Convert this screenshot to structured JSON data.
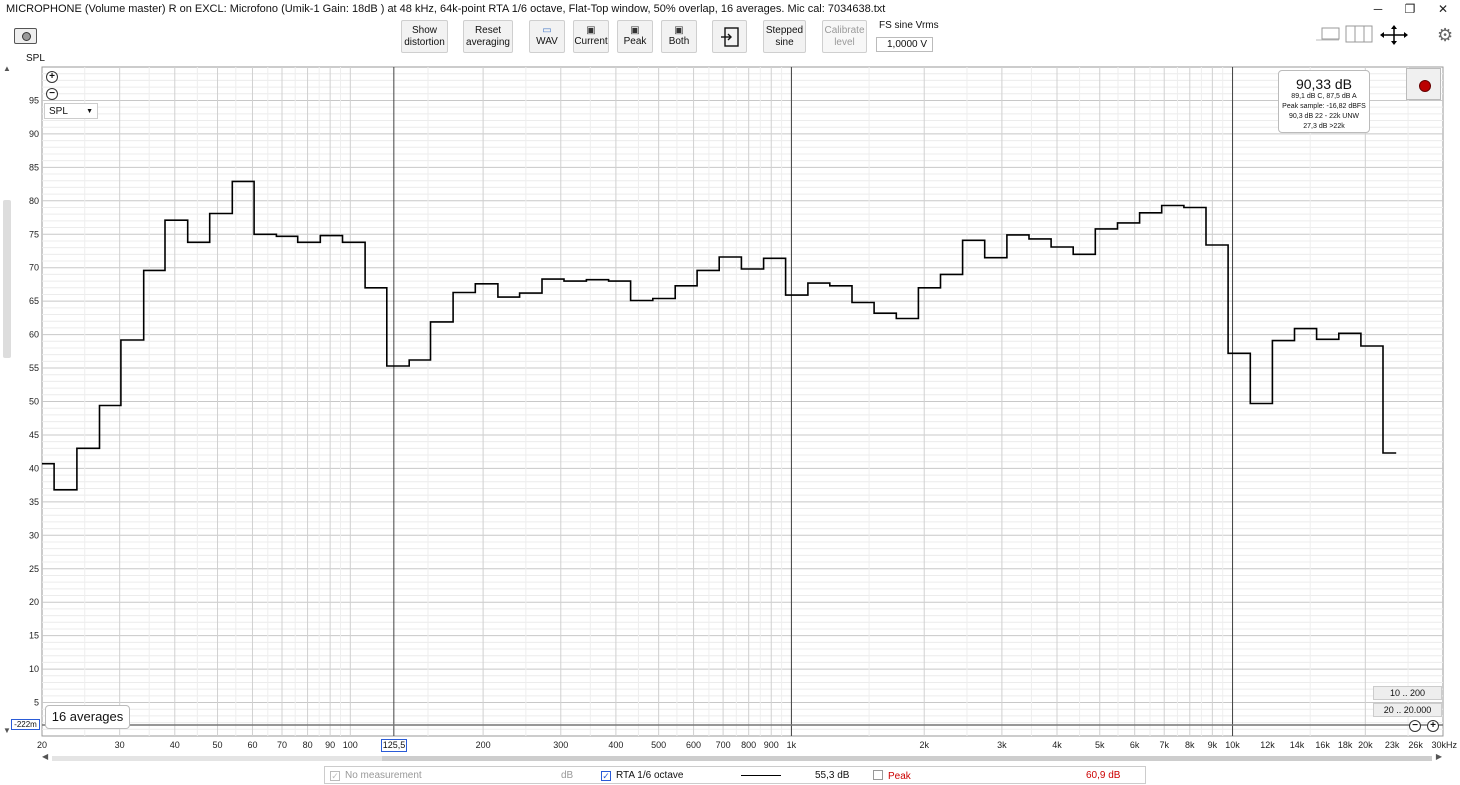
{
  "window": {
    "title": "MICROPHONE (Volume master) R on EXCL: Microfono (Umik-1  Gain: 18dB  ) at 48 kHz, 64k-point RTA 1/6 octave, Flat-Top window, 50% overlap, 16 averages. Mic cal: 7034638.txt",
    "minimize": "─",
    "restore": "❐",
    "close": "✕"
  },
  "toolbar": {
    "show_distortion": [
      "Show",
      "distortion"
    ],
    "reset_averaging": [
      "Reset",
      "averaging"
    ],
    "wav": "WAV",
    "current": "Current",
    "peak": "Peak",
    "both": "Both",
    "stepped_sine": [
      "Stepped",
      "sine"
    ],
    "calibrate_level": [
      "Calibrate",
      "level"
    ],
    "fs_label": "FS sine Vrms",
    "fs_value": "1,0000 V"
  },
  "plot": {
    "y_axis_label": "SPL",
    "spl_select": "SPL",
    "y_min_readout": "-222m",
    "cursor_readout": "125,5",
    "averages_badge": "16 averages",
    "range_buttons": [
      "10 .. 200",
      "20 .. 20.000"
    ]
  },
  "level_meter": {
    "main": "90,33 dB",
    "lines": [
      "89,1 dB C, 87,5 dB A",
      "Peak sample: -16,82 dBFS",
      "90,3 dB 22 - 22k UNW",
      "27,3 dB >22k"
    ]
  },
  "legend": {
    "no_measurement": "No measurement",
    "no_measurement_unit": "dB",
    "rta_label": "RTA 1/6 octave",
    "rta_value": "55,3 dB",
    "peak_label": "Peak",
    "peak_value": "60,9 dB",
    "colors": {
      "rta": "#000000",
      "peak": "#cc0000",
      "disabled": "#999999"
    }
  },
  "chart_data": {
    "type": "line",
    "step": true,
    "xscale": "log",
    "ylabel": "SPL",
    "xlim": [
      20,
      30000
    ],
    "ylim": [
      0,
      100
    ],
    "y_ticks": [
      5,
      10,
      15,
      20,
      25,
      30,
      35,
      40,
      45,
      50,
      55,
      60,
      65,
      70,
      75,
      80,
      85,
      90,
      95
    ],
    "x_tick_labels": [
      {
        "v": 20,
        "t": "20"
      },
      {
        "v": 30,
        "t": "30"
      },
      {
        "v": 40,
        "t": "40"
      },
      {
        "v": 50,
        "t": "50"
      },
      {
        "v": 60,
        "t": "60"
      },
      {
        "v": 70,
        "t": "70"
      },
      {
        "v": 80,
        "t": "80"
      },
      {
        "v": 90,
        "t": "90"
      },
      {
        "v": 100,
        "t": "100"
      },
      {
        "v": 200,
        "t": "200"
      },
      {
        "v": 300,
        "t": "300"
      },
      {
        "v": 400,
        "t": "400"
      },
      {
        "v": 500,
        "t": "500"
      },
      {
        "v": 600,
        "t": "600"
      },
      {
        "v": 700,
        "t": "700"
      },
      {
        "v": 800,
        "t": "800"
      },
      {
        "v": 900,
        "t": "900"
      },
      {
        "v": 1000,
        "t": "1k"
      },
      {
        "v": 2000,
        "t": "2k"
      },
      {
        "v": 3000,
        "t": "3k"
      },
      {
        "v": 4000,
        "t": "4k"
      },
      {
        "v": 5000,
        "t": "5k"
      },
      {
        "v": 6000,
        "t": "6k"
      },
      {
        "v": 7000,
        "t": "7k"
      },
      {
        "v": 8000,
        "t": "8k"
      },
      {
        "v": 9000,
        "t": "9k"
      },
      {
        "v": 10000,
        "t": "10k"
      },
      {
        "v": 12000,
        "t": "12k"
      },
      {
        "v": 14000,
        "t": "14k"
      },
      {
        "v": 16000,
        "t": "16k"
      },
      {
        "v": 18000,
        "t": "18k"
      },
      {
        "v": 20000,
        "t": "20k"
      },
      {
        "v": 23000,
        "t": "23k"
      },
      {
        "v": 26000,
        "t": "26k"
      },
      {
        "v": 30000,
        "t": "30kHz"
      }
    ],
    "major_vlines": [
      125.5,
      1000,
      10000
    ],
    "series": [
      {
        "edges": [
          20,
          21.3,
          24,
          27,
          30.2,
          34,
          38,
          42.8,
          48,
          54,
          60.5,
          68,
          76,
          85.5,
          96,
          108,
          121,
          136,
          152,
          171,
          192,
          216,
          242,
          272,
          305,
          343,
          385,
          432,
          485,
          545,
          611,
          686,
          770,
          865,
          970,
          1090,
          1222,
          1372,
          1540,
          1729,
          1940,
          2178,
          2444,
          2743,
          3079,
          3456,
          3879,
          4354,
          4886,
          5485,
          6156,
          6910,
          7756,
          8706,
          9772,
          10969,
          12312,
          13820,
          15512,
          17412,
          19544,
          21937,
          23500
        ],
        "values": [
          40.7,
          36.8,
          43.0,
          49.4,
          59.2,
          69.6,
          77.1,
          73.8,
          78.1,
          82.9,
          75.0,
          74.7,
          73.8,
          74.8,
          73.8,
          67.0,
          55.3,
          56.2,
          61.9,
          66.3,
          67.6,
          65.6,
          66.2,
          68.3,
          68.0,
          68.2,
          68.0,
          65.1,
          65.4,
          67.3,
          69.6,
          71.6,
          69.8,
          71.4,
          65.9,
          67.7,
          67.3,
          64.8,
          63.2,
          62.4,
          67.0,
          69.0,
          74.1,
          71.5,
          74.9,
          74.3,
          73.1,
          72.0,
          75.8,
          76.7,
          78.2,
          79.3,
          79.0,
          73.4,
          57.2,
          49.7,
          59.1,
          60.9,
          59.3,
          60.2,
          58.3,
          42.3
        ]
      }
    ]
  }
}
